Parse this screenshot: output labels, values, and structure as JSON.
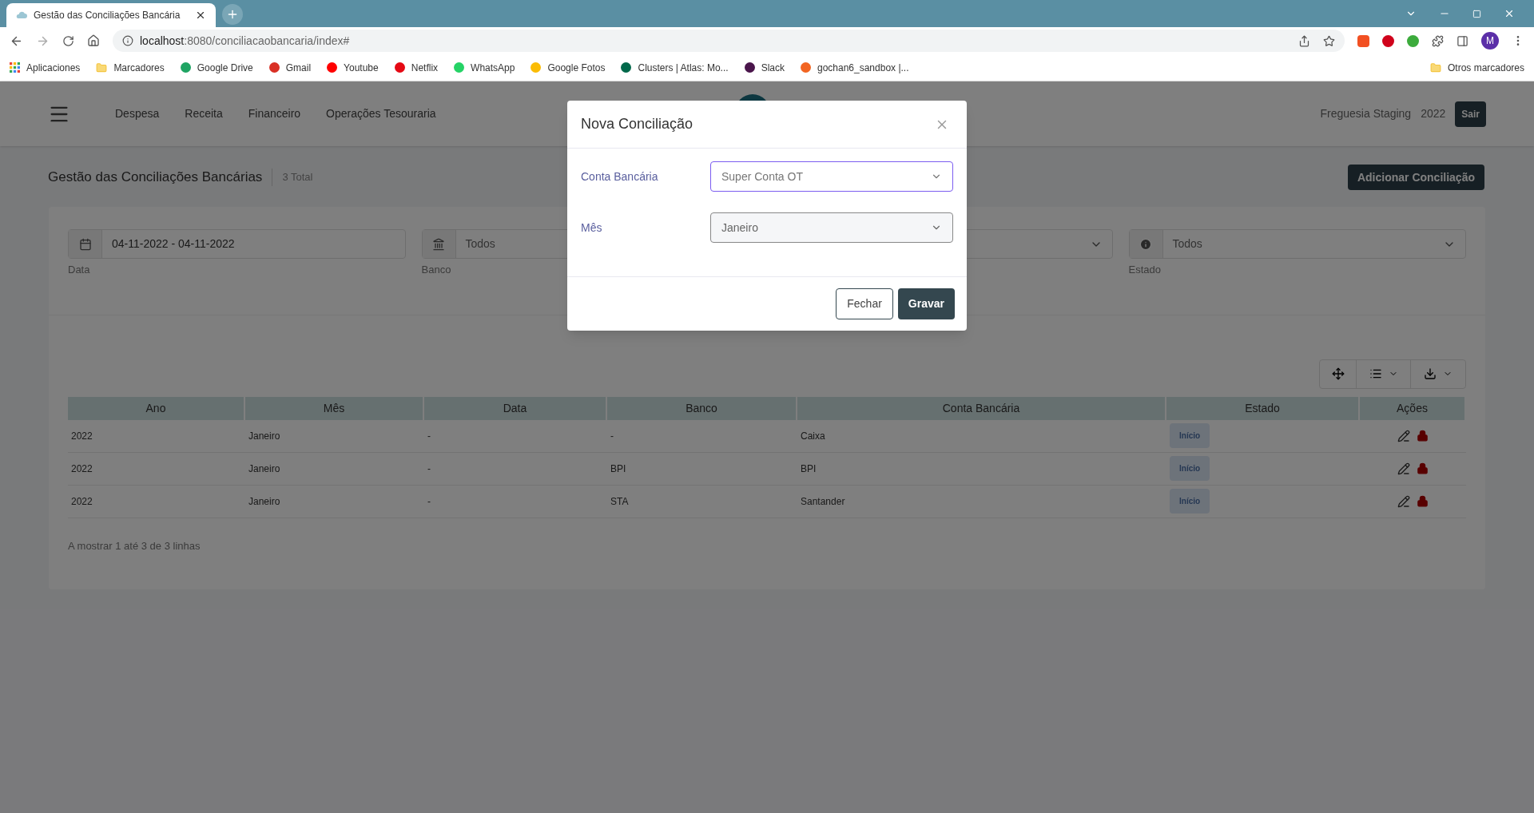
{
  "browser": {
    "tabs": [
      {
        "title": "Gestão das Conciliações Bancária",
        "selected": true
      }
    ],
    "url_host": "localhost",
    "url_path": ":8080/conciliacaobancaria/index#",
    "profile_initial": "M",
    "bookmarks": [
      {
        "label": "Aplicaciones"
      },
      {
        "label": "Marcadores"
      },
      {
        "label": "Google Drive"
      },
      {
        "label": "Gmail"
      },
      {
        "label": "Youtube"
      },
      {
        "label": "Netflix"
      },
      {
        "label": "WhatsApp"
      },
      {
        "label": "Google Fotos"
      },
      {
        "label": "Clusters | Atlas: Mo..."
      },
      {
        "label": "Slack"
      },
      {
        "label": "gochan6_sandbox |..."
      }
    ],
    "other_bookmarks": "Otros marcadores"
  },
  "nav": {
    "items": [
      "Despesa",
      "Receita",
      "Financeiro",
      "Operações Tesouraria"
    ],
    "org": "Freguesia Staging",
    "year": "2022",
    "logout": "Sair"
  },
  "page": {
    "title": "Gestão das Conciliações Bancárias",
    "total": "3 Total",
    "add_button": "Adicionar Conciliação"
  },
  "filters": [
    {
      "kind": "date",
      "value": "04-11-2022 - 04-11-2022",
      "label": "Data"
    },
    {
      "kind": "bank",
      "value": "Todos",
      "label": "Banco"
    },
    {
      "kind": "hidden"
    },
    {
      "kind": "status",
      "value": "Todos",
      "label": "Estado"
    }
  ],
  "table": {
    "columns": [
      "Ano",
      "Mês",
      "Data",
      "Banco",
      "Conta Bancária",
      "Estado",
      "Ações"
    ],
    "rows": [
      {
        "cells": [
          "2022",
          "Janeiro",
          "-",
          "-",
          "Caixa"
        ],
        "status": "Início"
      },
      {
        "cells": [
          "2022",
          "Janeiro",
          "-",
          "BPI",
          "BPI"
        ],
        "status": "Início"
      },
      {
        "cells": [
          "2022",
          "Janeiro",
          "-",
          "STA",
          "Santander"
        ],
        "status": "Início"
      }
    ],
    "footer": "A mostrar 1 até 3 de 3 linhas"
  },
  "modal": {
    "title": "Nova Conciliação",
    "fields": [
      {
        "label": "Conta Bancária",
        "value": "Super Conta OT",
        "focused": true,
        "disabled": false
      },
      {
        "label": "Mês",
        "value": "Janeiro",
        "focused": false,
        "disabled": true
      }
    ],
    "buttons": [
      {
        "label": "Fechar",
        "kind": "secondary"
      },
      {
        "label": "Gravar",
        "kind": "primary"
      }
    ]
  }
}
